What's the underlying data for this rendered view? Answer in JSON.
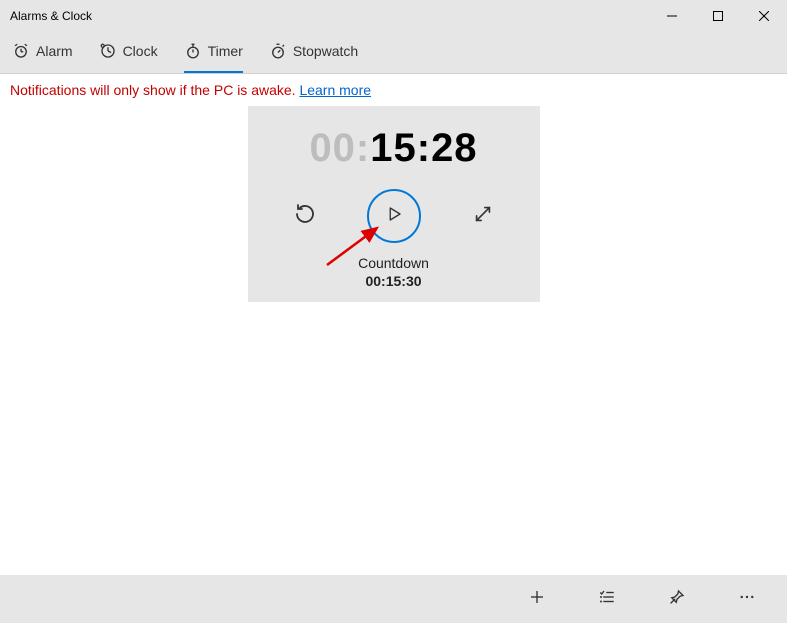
{
  "window": {
    "title": "Alarms & Clock"
  },
  "tabs": {
    "alarm": "Alarm",
    "clock": "Clock",
    "timer": "Timer",
    "stopwatch": "Stopwatch",
    "active": "timer"
  },
  "notification": {
    "text": "Notifications will only show if the PC is awake. ",
    "link": "Learn more"
  },
  "timer": {
    "hours_dim": "00:",
    "minsec": "15:28",
    "label": "Countdown",
    "set_time": "00:15:30"
  }
}
